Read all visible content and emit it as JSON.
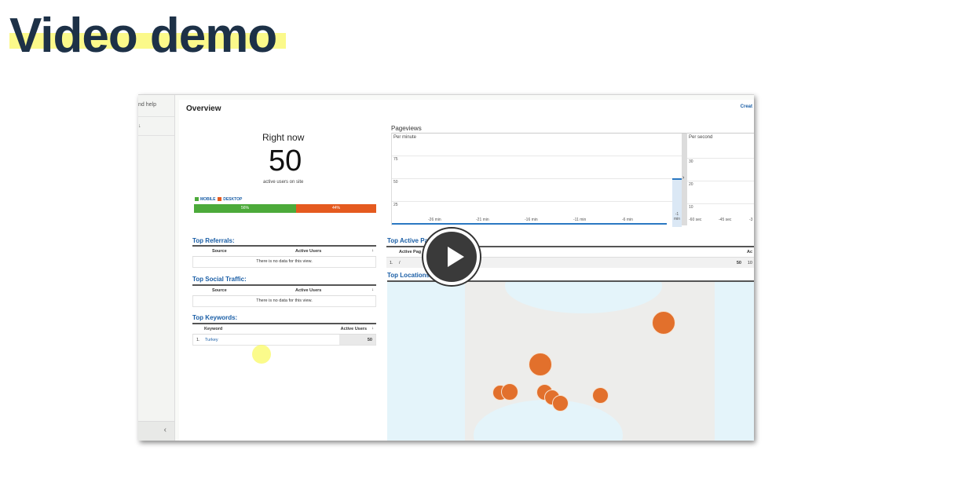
{
  "slide": {
    "title": "Video demo"
  },
  "sidebar": {
    "help_text": "nd help",
    "chevron": "↓",
    "collapse": "‹"
  },
  "header": {
    "title": "Overview",
    "create_link": "Creat"
  },
  "right_now": {
    "label": "Right now",
    "count": "50",
    "sublabel": "active users on site",
    "legend": [
      {
        "label": "MOBILE",
        "color": "#4caa3a"
      },
      {
        "label": "DESKTOP",
        "color": "#e55a1f"
      }
    ],
    "split": [
      {
        "label": "56%",
        "value": 56,
        "color": "#4caa3a"
      },
      {
        "label": "44%",
        "value": 44,
        "color": "#e55a1f"
      }
    ]
  },
  "pageviews": {
    "title": "Pageviews",
    "per_minute": {
      "label": "Per minute",
      "y_ticks": [
        "75",
        "50",
        "25"
      ],
      "x_ticks": [
        "-26 min",
        "-21 min",
        "-16 min",
        "-11 min",
        "-6 min",
        "-1 min"
      ]
    },
    "per_second": {
      "label": "Per second",
      "y_ticks": [
        "30",
        "20",
        "10"
      ],
      "x_ticks": [
        "-60 sec",
        "-45 sec",
        "-3"
      ]
    },
    "expand_icon": "›"
  },
  "top_referrals": {
    "title": "Top Referrals:",
    "columns": [
      "Source",
      "Active Users"
    ],
    "sort_icon": "↓",
    "empty": "There is no data for this view."
  },
  "top_social": {
    "title": "Top Social Traffic:",
    "columns": [
      "Source",
      "Active Users"
    ],
    "sort_icon": "↓",
    "empty": "There is no data for this view."
  },
  "top_keywords": {
    "title": "Top Keywords:",
    "columns": [
      "Keyword",
      "Active Users"
    ],
    "sort_icon": "↓",
    "rows": [
      {
        "index": "1.",
        "keyword": "Turkey",
        "users": "50"
      }
    ]
  },
  "top_active_pages": {
    "title": "Top Active Pa",
    "columns": [
      "Active Pag",
      "Ac"
    ],
    "rows": [
      {
        "index": "1.",
        "page": "/",
        "users": "50",
        "pct": "10"
      }
    ]
  },
  "top_locations": {
    "title": "Top Locations:"
  },
  "play_button": {
    "icon": "play-icon"
  }
}
